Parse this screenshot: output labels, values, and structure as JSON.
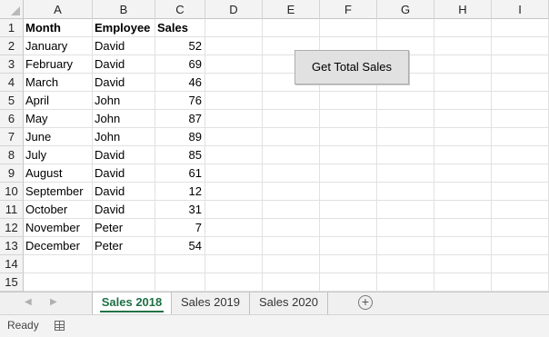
{
  "columns": [
    "A",
    "B",
    "C",
    "D",
    "E",
    "F",
    "G",
    "H",
    "I"
  ],
  "rows": [
    "1",
    "2",
    "3",
    "4",
    "5",
    "6",
    "7",
    "8",
    "9",
    "10",
    "11",
    "12",
    "13",
    "14",
    "15"
  ],
  "table": {
    "header": {
      "month": "Month",
      "employee": "Employee",
      "sales": "Sales"
    },
    "records": [
      {
        "month": "January",
        "employee": "David",
        "sales": "52"
      },
      {
        "month": "February",
        "employee": "David",
        "sales": "69"
      },
      {
        "month": "March",
        "employee": "David",
        "sales": "46"
      },
      {
        "month": "April",
        "employee": "John",
        "sales": "76"
      },
      {
        "month": "May",
        "employee": "John",
        "sales": "87"
      },
      {
        "month": "June",
        "employee": "John",
        "sales": "89"
      },
      {
        "month": "July",
        "employee": "David",
        "sales": "85"
      },
      {
        "month": "August",
        "employee": "David",
        "sales": "61"
      },
      {
        "month": "September",
        "employee": "David",
        "sales": "12"
      },
      {
        "month": "October",
        "employee": "David",
        "sales": "31"
      },
      {
        "month": "November",
        "employee": "Peter",
        "sales": "7"
      },
      {
        "month": "December",
        "employee": "Peter",
        "sales": "54"
      }
    ]
  },
  "macro_button": {
    "label": "Get Total Sales"
  },
  "sheet_tabs": [
    {
      "label": "Sales 2018",
      "active": true
    },
    {
      "label": "Sales 2019",
      "active": false
    },
    {
      "label": "Sales 2020",
      "active": false
    }
  ],
  "add_sheet_symbol": "+",
  "nav": {
    "prev": "◀",
    "next": "▶"
  },
  "status": {
    "text": "Ready",
    "icon": "sheet-view-icon"
  },
  "colors": {
    "accent": "#217346",
    "active_tab_text": "#1e7145"
  }
}
